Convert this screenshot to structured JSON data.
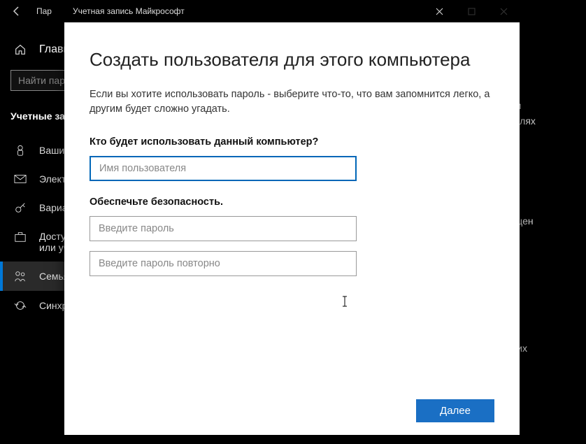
{
  "outer": {
    "title_bar": "Пар",
    "home": "Главна",
    "search_placeholder": "Найти пар",
    "section": "Учетные за",
    "nav": [
      {
        "icon": "person",
        "label": "Ваши д"
      },
      {
        "icon": "mail",
        "label": "Электр"
      },
      {
        "icon": "key",
        "label": "Вариан"
      },
      {
        "icon": "work",
        "label": "Доступ\nили уч"
      },
      {
        "icon": "family",
        "label": "Семья"
      },
      {
        "icon": "sync",
        "label": "Синхро"
      }
    ],
    "bg_fragments": [
      "ми",
      "целях",
      "ещен",
      "ь их"
    ]
  },
  "dialog": {
    "title_bar": "Учетная запись Майкрософт",
    "heading": "Создать пользователя для этого компьютера",
    "intro": "Если вы хотите использовать пароль - выберите что-то, что вам запомнится легко, а другим будет сложно угадать.",
    "question1": "Кто будет использовать данный компьютер?",
    "username_placeholder": "Имя пользователя",
    "question2": "Обеспечьте безопасность.",
    "password_placeholder": "Введите пароль",
    "password2_placeholder": "Введите пароль повторно",
    "next_button": "Далее"
  }
}
